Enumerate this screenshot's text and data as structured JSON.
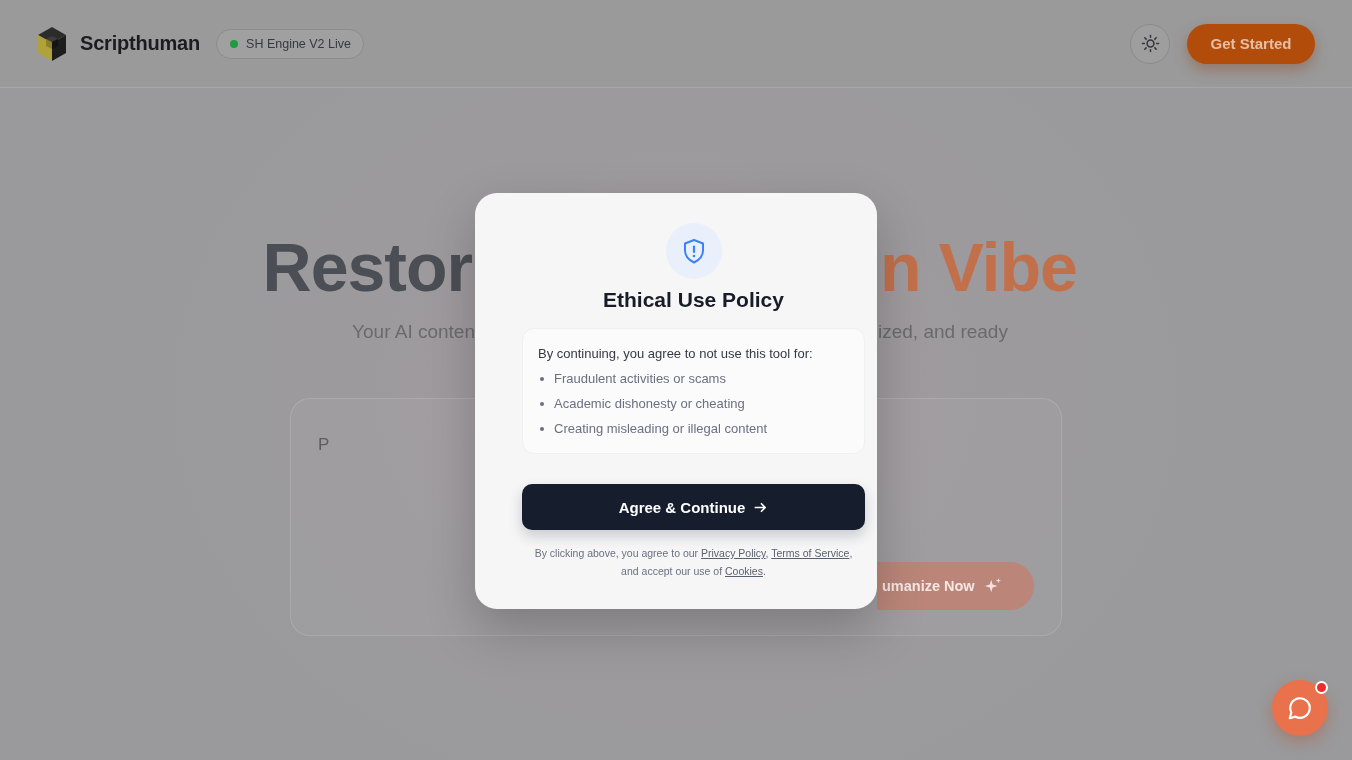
{
  "header": {
    "brand": "Scripthuman",
    "status_badge": "SH Engine V2 Live",
    "cta_button": "Get Started"
  },
  "hero": {
    "heading": [
      {
        "text": "Restor",
        "accent": false
      },
      {
        "text": "n Vibe",
        "accent": true
      }
    ],
    "subtitle": [
      "Your AI conten",
      "ized, and ready"
    ]
  },
  "editor": {
    "placeholder": "P",
    "submit_button": "umanize Now"
  },
  "modal": {
    "title": "Ethical Use Policy",
    "intro": "By continuing, you agree to not use this tool for:",
    "prohibited_uses": [
      "Fraudulent activities or scams",
      "Academic dishonesty or cheating",
      "Creating misleading or illegal content"
    ],
    "confirm_button": "Agree & Continue",
    "footer_lines": [
      [
        {
          "kind": "text",
          "text": "By clicking above, you agree to our "
        },
        {
          "kind": "link",
          "text": "Privacy Policy"
        },
        {
          "kind": "text",
          "text": ", "
        },
        {
          "kind": "link",
          "text": "Terms of Service"
        },
        {
          "kind": "text",
          "text": ","
        }
      ],
      [
        {
          "kind": "text",
          "text": "and accept our use of "
        },
        {
          "kind": "link",
          "text": "Cookies"
        },
        {
          "kind": "text",
          "text": "."
        }
      ]
    ]
  },
  "chat_widget": {
    "unread": true
  }
}
